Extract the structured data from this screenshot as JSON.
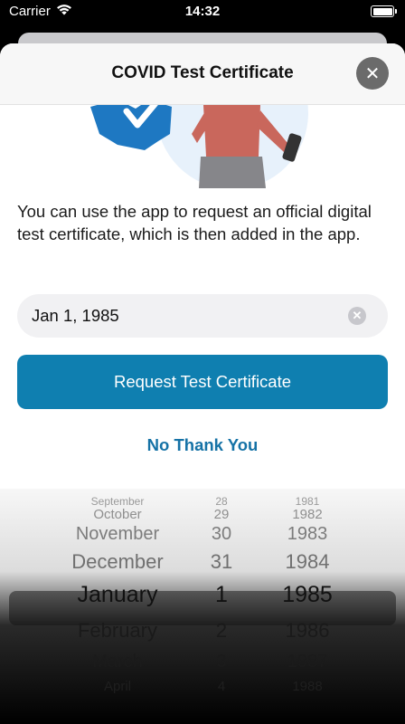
{
  "status_bar": {
    "carrier": "Carrier",
    "time": "14:32"
  },
  "sheet": {
    "title": "COVID Test Certificate",
    "close_glyph": "✕"
  },
  "intro_text": "You can use the app to request an official digital test certificate, which is then added in the app.",
  "date_field": {
    "value": "Jan 1, 1985",
    "clear_glyph": "✕"
  },
  "buttons": {
    "primary": "Request Test Certificate",
    "secondary": "No Thank You"
  },
  "picker": {
    "rows": [
      {
        "month": "September",
        "day": "28",
        "year": "1981"
      },
      {
        "month": "October",
        "day": "29",
        "year": "1982"
      },
      {
        "month": "November",
        "day": "30",
        "year": "1983"
      },
      {
        "month": "December",
        "day": "31",
        "year": "1984"
      },
      {
        "month": "January",
        "day": "1",
        "year": "1985"
      },
      {
        "month": "February",
        "day": "2",
        "year": "1986"
      },
      {
        "month": "March",
        "day": "3",
        "year": "1987"
      },
      {
        "month": "April",
        "day": "4",
        "year": "1988"
      }
    ],
    "selected_index": 4
  },
  "colors": {
    "accent": "#0f7fb0",
    "link": "#1572a6",
    "illustration_blue": "#1e78c2"
  }
}
